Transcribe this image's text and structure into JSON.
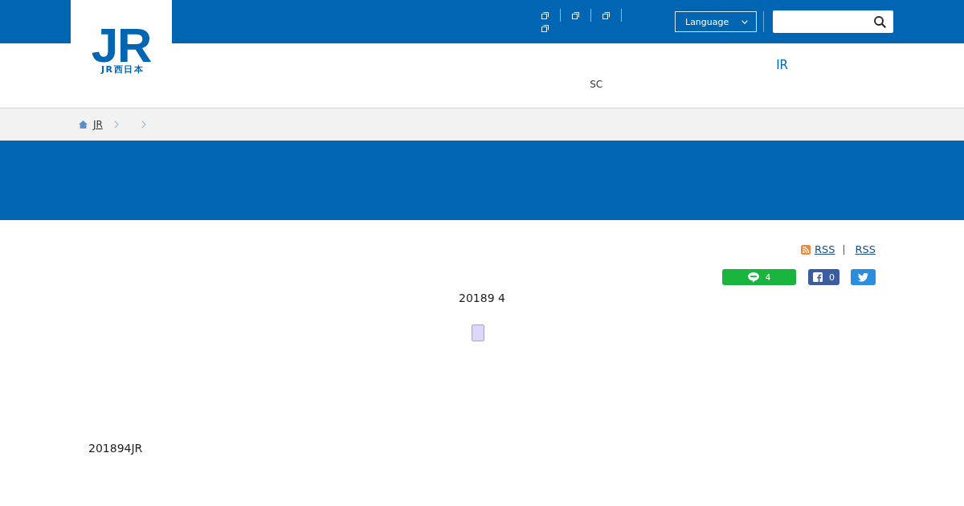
{
  "header": {
    "logo": {
      "mark": "JR",
      "wordmark": "JR西日本"
    },
    "utility_links": [
      {
        "external": true
      },
      {
        "external": true
      },
      {
        "external": true
      },
      {
        "external": true
      }
    ],
    "language": {
      "label": "Language"
    },
    "nav": [
      {
        "label": "SC",
        "kind": "sub"
      },
      {
        "label": "IR",
        "kind": "main"
      }
    ]
  },
  "breadcrumb": [
    {
      "kind": "home",
      "label": "JR"
    },
    {
      "kind": "page"
    },
    {
      "kind": "page"
    }
  ],
  "feeds": [
    {
      "label": "RSS",
      "kind": "icon"
    },
    {
      "label": "RSS",
      "kind": "plain"
    }
  ],
  "share": [
    {
      "kind": "line",
      "count": "4"
    },
    {
      "kind": "facebook",
      "count": "0"
    },
    {
      "kind": "twitter"
    }
  ],
  "article": {
    "date": "20189 4",
    "body": "201894JR"
  }
}
